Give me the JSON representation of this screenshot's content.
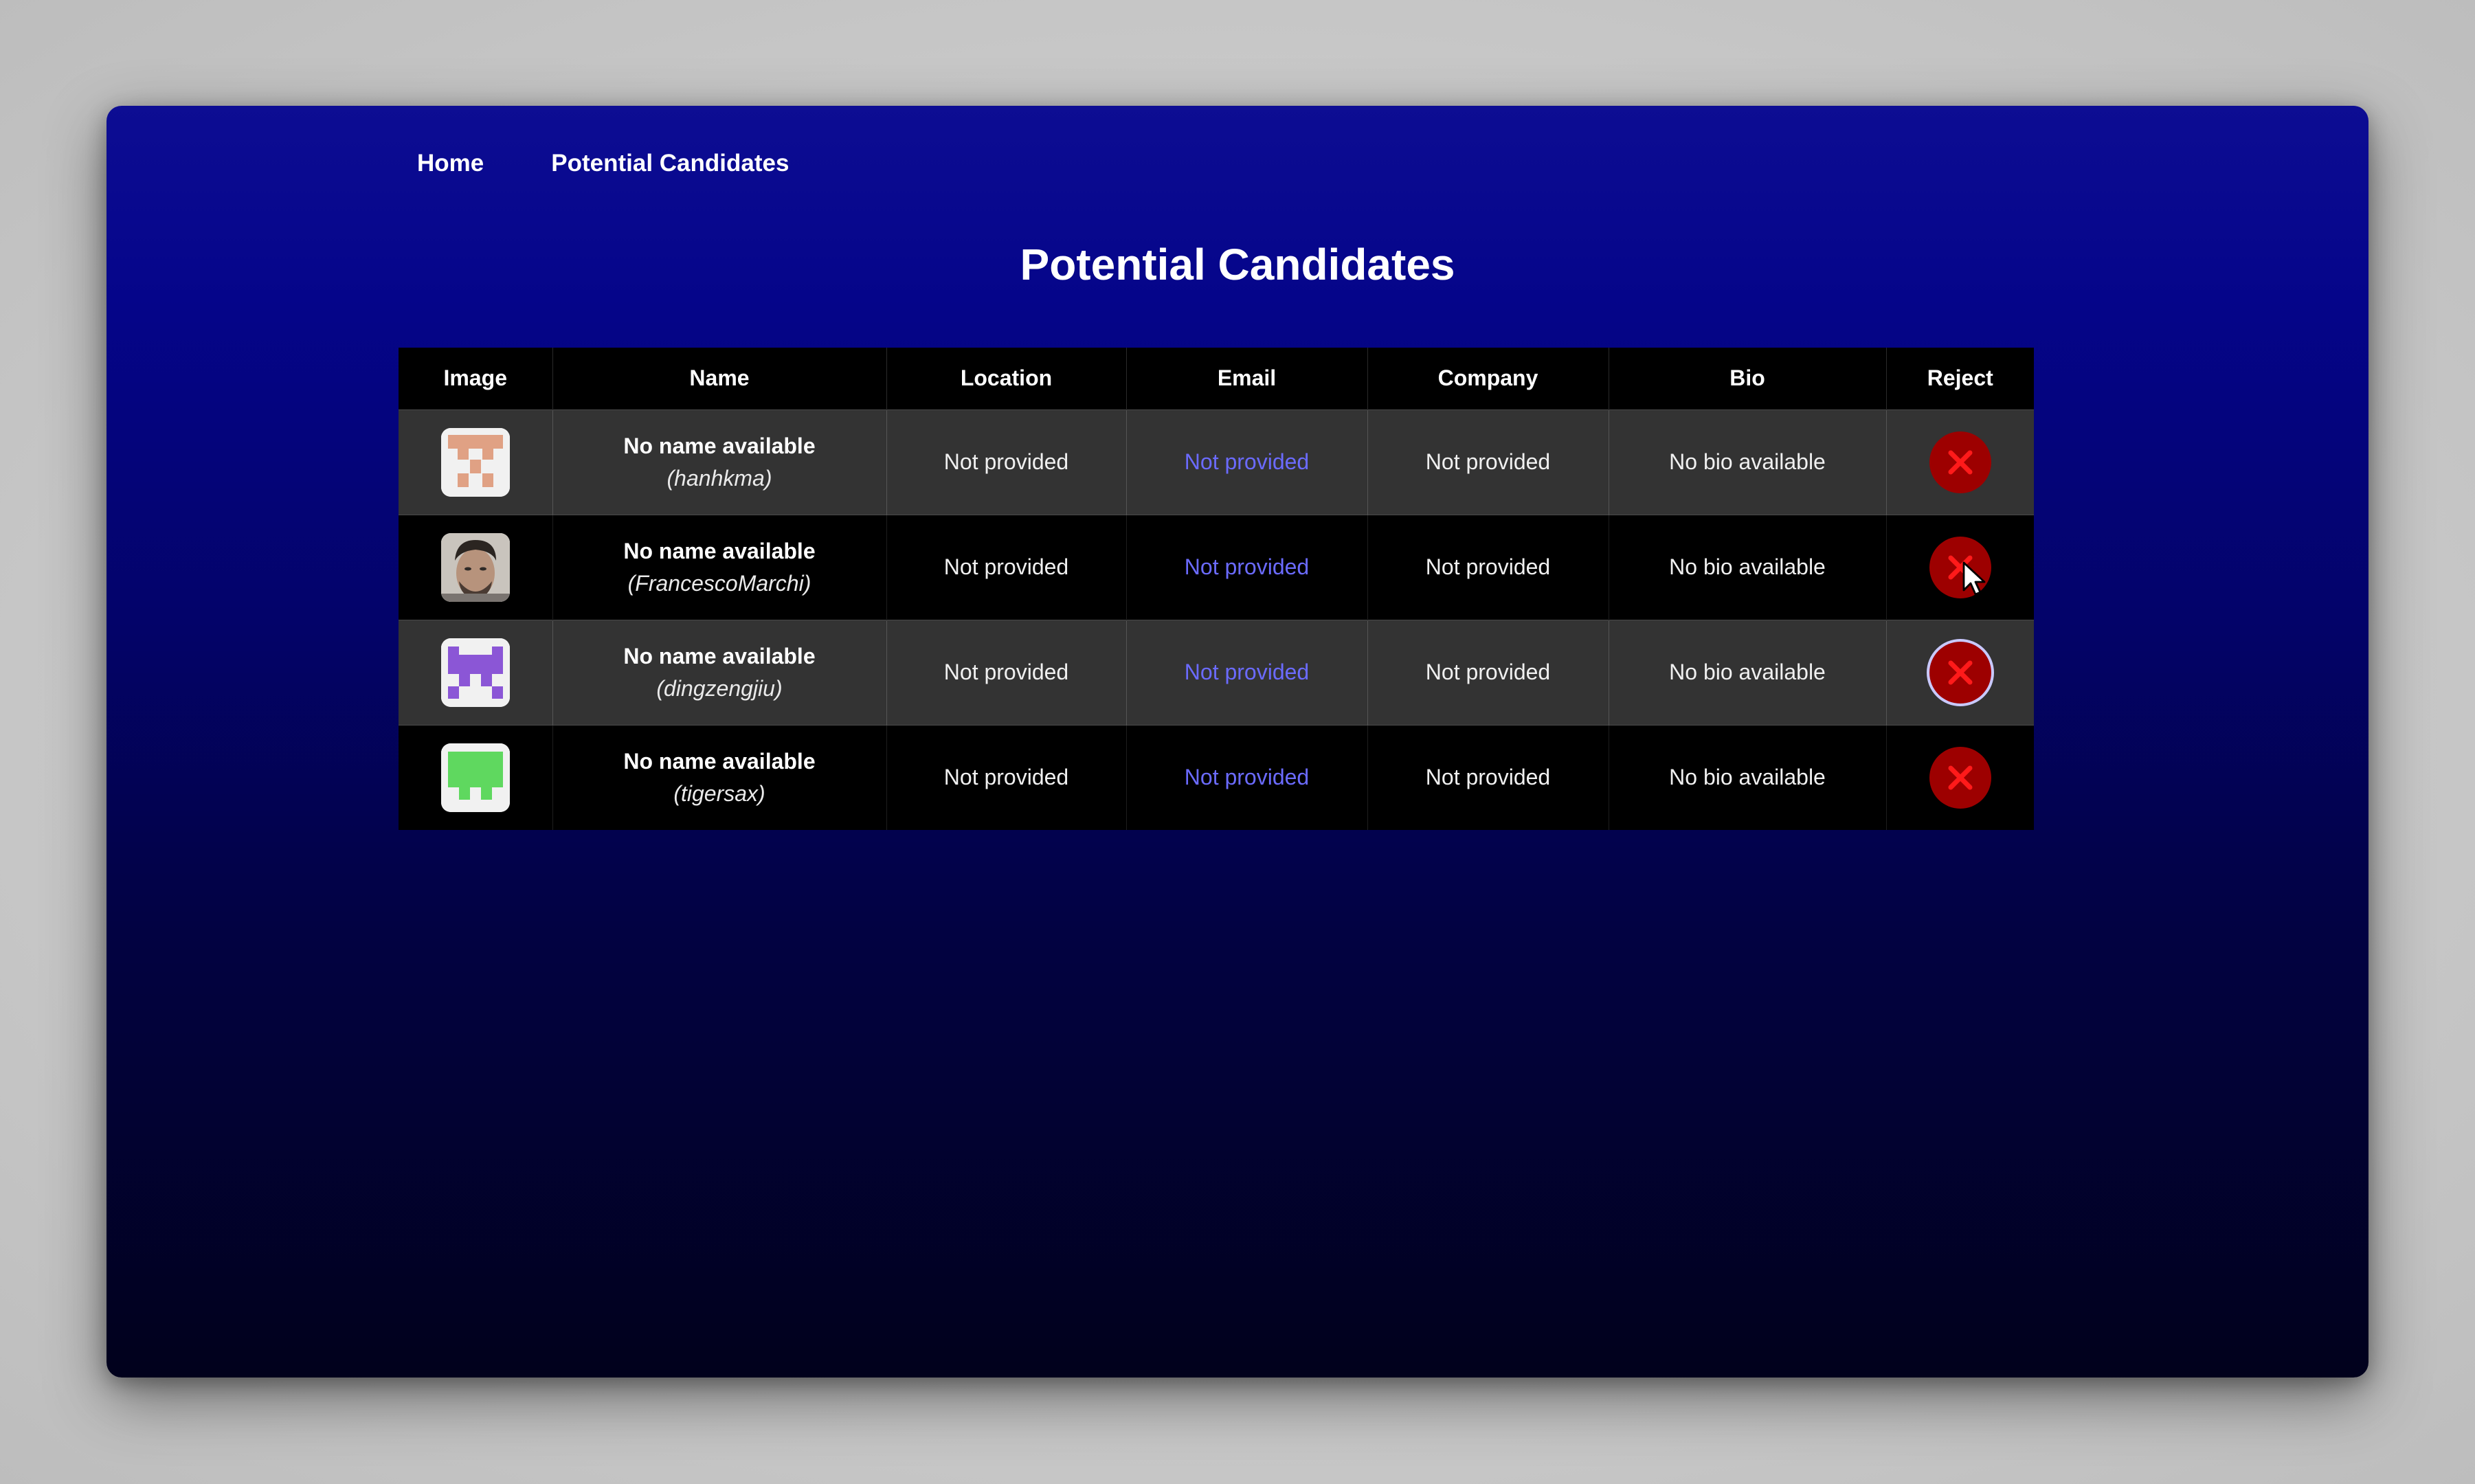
{
  "nav": {
    "home": "Home",
    "candidates": "Potential Candidates"
  },
  "page": {
    "title": "Potential Candidates"
  },
  "table": {
    "headers": [
      "Image",
      "Name",
      "Location",
      "Email",
      "Company",
      "Bio",
      "Reject"
    ],
    "rows": [
      {
        "name": "No name available",
        "handle": "(hanhkma)",
        "location": "Not provided",
        "email": "Not provided",
        "company": "Not provided",
        "bio": "No bio available",
        "avatar": "pixel-avatar-orange-icon"
      },
      {
        "name": "No name available",
        "handle": "(FrancescoMarchi)",
        "location": "Not provided",
        "email": "Not provided",
        "company": "Not provided",
        "bio": "No bio available",
        "avatar": "photo-avatar"
      },
      {
        "name": "No name available",
        "handle": "(dingzengjiu)",
        "location": "Not provided",
        "email": "Not provided",
        "company": "Not provided",
        "bio": "No bio available",
        "avatar": "pixel-avatar-purple-icon"
      },
      {
        "name": "No name available",
        "handle": "(tigersax)",
        "location": "Not provided",
        "email": "Not provided",
        "company": "Not provided",
        "bio": "No bio available",
        "avatar": "pixel-avatar-green-icon"
      }
    ]
  },
  "colors": {
    "background_top": "#0d0d93",
    "background_bottom": "#01011c",
    "link": "#6b6bff",
    "reject": "#9d0000",
    "reject_x": "#ff1a1a"
  }
}
